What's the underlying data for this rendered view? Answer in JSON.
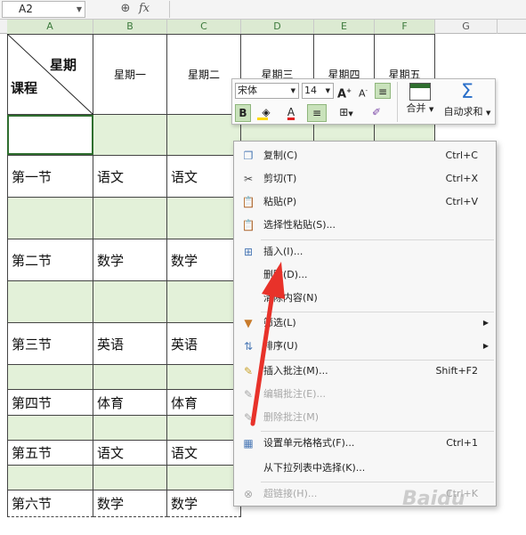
{
  "formula_bar": {
    "name_box": "A2",
    "zoom_icon": "zoom-icon",
    "fx": "fx"
  },
  "columns": [
    "A",
    "B",
    "C",
    "D",
    "E",
    "F",
    "G"
  ],
  "corner": {
    "top": "星期",
    "bottom": "课程"
  },
  "weekdays": [
    "星期一",
    "星期二",
    "星期三",
    "星期四",
    "星期五"
  ],
  "rows": [
    {
      "label": "第一节",
      "mon": "语文",
      "tue": "语文"
    },
    {
      "label": "第二节",
      "mon": "数学",
      "tue": "数学"
    },
    {
      "label": "第三节",
      "mon": "英语",
      "tue": "英语"
    },
    {
      "label": "第四节",
      "mon": "体育",
      "tue": "体育"
    },
    {
      "label": "第五节",
      "mon": "语文",
      "tue": "语文"
    },
    {
      "label": "第六节",
      "mon": "数学",
      "tue": "数学"
    }
  ],
  "mini_toolbar": {
    "font": "宋体",
    "size": "14",
    "grow": "A",
    "shrink": "A",
    "bold": "B",
    "font_color": "A",
    "merge": "合并",
    "autosum": "自动求和",
    "sigma": "Σ"
  },
  "context_menu": [
    {
      "label": "复制(C)",
      "shortcut": "Ctrl+C",
      "icon": "copy-icon",
      "glyph": "❐"
    },
    {
      "label": "剪切(T)",
      "shortcut": "Ctrl+X",
      "icon": "scissors-icon",
      "glyph": "✂"
    },
    {
      "label": "粘贴(P)",
      "shortcut": "Ctrl+V",
      "icon": "paste-icon",
      "glyph": "📋"
    },
    {
      "label": "选择性粘贴(S)...",
      "shortcut": "",
      "icon": "paste-special-icon",
      "glyph": "📋"
    },
    {
      "label": "插入(I)...",
      "shortcut": "",
      "icon": "insert-icon",
      "glyph": "⊞"
    },
    {
      "label": "删除(D)...",
      "shortcut": "",
      "icon": "",
      "glyph": ""
    },
    {
      "label": "清除内容(N)",
      "shortcut": "",
      "icon": "",
      "glyph": ""
    },
    {
      "label": "筛选(L)",
      "shortcut": "",
      "icon": "filter-icon",
      "glyph": "▼"
    },
    {
      "label": "排序(U)",
      "shortcut": "",
      "icon": "sort-icon",
      "glyph": "⇅"
    },
    {
      "label": "插入批注(M)...",
      "shortcut": "Shift+F2",
      "icon": "insert-comment-icon",
      "glyph": "✎"
    },
    {
      "label": "编辑批注(E)...",
      "shortcut": "",
      "icon": "edit-comment-icon",
      "glyph": "✎"
    },
    {
      "label": "删除批注(M)",
      "shortcut": "",
      "icon": "delete-comment-icon",
      "glyph": "✎"
    },
    {
      "label": "设置单元格格式(F)...",
      "shortcut": "Ctrl+1",
      "icon": "format-cells-icon",
      "glyph": "▦"
    },
    {
      "label": "从下拉列表中选择(K)...",
      "shortcut": "",
      "icon": "",
      "glyph": ""
    },
    {
      "label": "超链接(H)...",
      "shortcut": "Ctrl+K",
      "icon": "hyperlink-icon",
      "glyph": "⊗"
    }
  ],
  "accent_color": "#2f6e2f",
  "highlight_fill": "#e3f1d9",
  "arrow_color": "#e8322a",
  "watermark": "Baidu"
}
